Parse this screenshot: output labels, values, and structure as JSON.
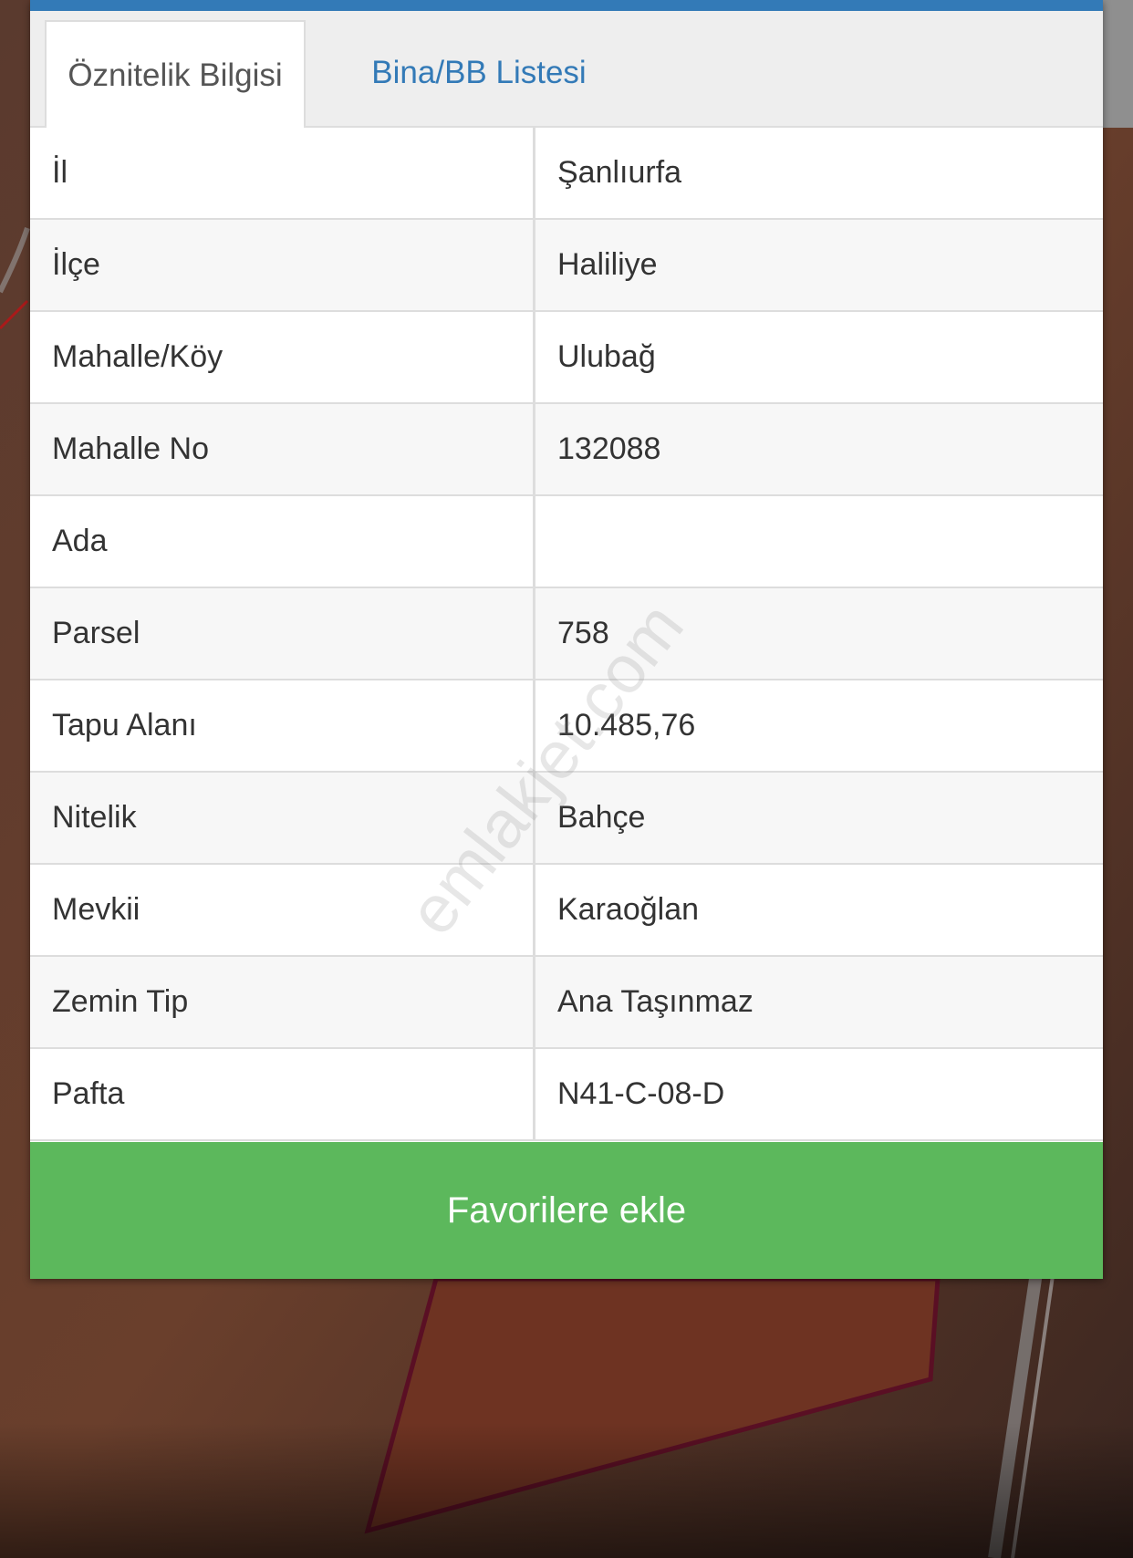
{
  "tabs": {
    "attribute_info": "Öznitelik Bilgisi",
    "building_list": "Bina/BB Listesi"
  },
  "attributes": [
    {
      "key": "İl",
      "value": "Şanlıurfa"
    },
    {
      "key": "İlçe",
      "value": "Haliliye"
    },
    {
      "key": "Mahalle/Köy",
      "value": "Ulubağ"
    },
    {
      "key": "Mahalle No",
      "value": "132088"
    },
    {
      "key": "Ada",
      "value": ""
    },
    {
      "key": "Parsel",
      "value": "758"
    },
    {
      "key": "Tapu Alanı",
      "value": "10.485,76"
    },
    {
      "key": "Nitelik",
      "value": "Bahçe"
    },
    {
      "key": "Mevkii",
      "value": "Karaoğlan"
    },
    {
      "key": "Zemin Tip",
      "value": "Ana Taşınmaz"
    },
    {
      "key": "Pafta",
      "value": "N41-C-08-D"
    }
  ],
  "actions": {
    "add_favorites_label": "Favorilere ekle"
  },
  "watermark": "emlakjet.com",
  "colors": {
    "accent_blue": "#337ab7",
    "button_green": "#5cb85c",
    "parcel_outline": "#5a0f24"
  }
}
